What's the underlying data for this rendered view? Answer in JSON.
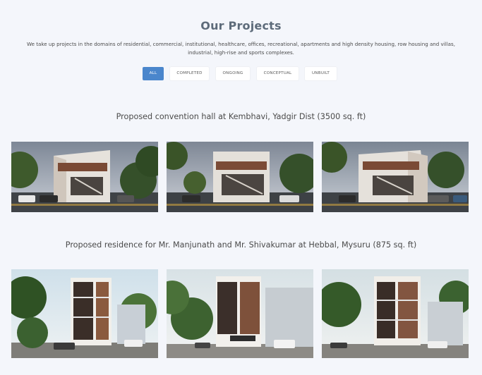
{
  "header": {
    "title": "Our Projects",
    "intro": "We take up projects in the domains of residential, commercial, institutional, healthcare, offices, recreational, apartments and high density housing, row housing and villas, industrial, high-rise and sports complexes."
  },
  "filters": [
    {
      "label": "ALL",
      "active": true
    },
    {
      "label": "COMPLETED",
      "active": false
    },
    {
      "label": "ONGOING",
      "active": false
    },
    {
      "label": "CONCEPTUAL",
      "active": false
    },
    {
      "label": "UNBUILT",
      "active": false
    }
  ],
  "projects": [
    {
      "title": "Proposed convention hall at Kembhavi, Yadgir Dist (3500 sq. ft)",
      "images": [
        "building-render-front",
        "building-render-side",
        "building-render-angle"
      ]
    },
    {
      "title": "Proposed residence for Mr. Manjunath and Mr. Shivakumar at Hebbal, Mysuru (875 sq. ft)",
      "images": [
        "residence-render-corner",
        "residence-render-front",
        "residence-render-angle"
      ]
    }
  ],
  "colors": {
    "accent": "#4a86cc",
    "background": "#f4f6fb",
    "title": "#5d6b7a"
  }
}
